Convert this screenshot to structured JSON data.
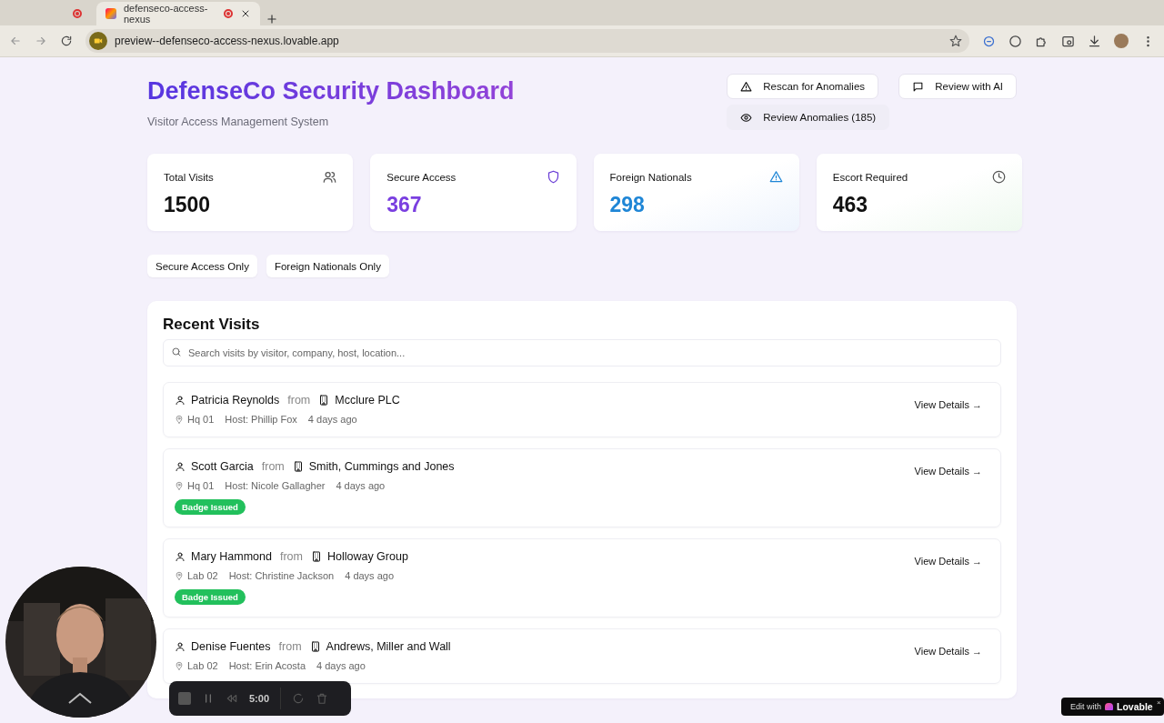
{
  "browser": {
    "tabs": [
      {
        "selected": false,
        "recording": true
      },
      {
        "title": "defenseco-access-nexus",
        "selected": true,
        "recording": true
      }
    ],
    "address": "preview--defenseco-access-nexus.lovable.app"
  },
  "header": {
    "title": "DefenseCo Security Dashboard",
    "subtitle": "Visitor Access Management System",
    "actions": [
      {
        "label": "Rescan for Anomalies",
        "kind": "outline"
      },
      {
        "label": "Review with AI",
        "kind": "outline"
      },
      {
        "label": "Review Anomalies (185)",
        "kind": "ghost"
      }
    ]
  },
  "stats": [
    {
      "label": "Total Visits",
      "value": "1500",
      "color": "#111111"
    },
    {
      "label": "Secure Access",
      "value": "367",
      "color": "#7a3fe0"
    },
    {
      "label": "Foreign Nationals",
      "value": "298",
      "color": "#1f86d6"
    },
    {
      "label": "Escort Required",
      "value": "463",
      "color": "#111111"
    }
  ],
  "filters": [
    {
      "label": "Secure Access Only",
      "selected": false
    },
    {
      "label": "Foreign Nationals Only",
      "selected": false
    }
  ],
  "recent_visits": {
    "title": "Recent Visits",
    "search": {
      "placeholder": "Search visits by visitor, company, host, location..."
    },
    "rows": [
      {
        "visitor": "Patricia Reynolds",
        "from": "from",
        "company": "Mcclure PLC",
        "location": "Hq 01",
        "host": "Host: Phillip Fox",
        "time": "4 days ago",
        "action": "View Details →"
      },
      {
        "visitor": "Scott Garcia",
        "from": "from",
        "company": "Smith, Cummings and Jones",
        "location": "Hq 01",
        "host": "Host: Nicole Gallagher",
        "time": "4 days ago",
        "badge": "Badge Issued",
        "action": "View Details →"
      },
      {
        "visitor": "Mary Hammond",
        "from": "from",
        "company": "Holloway Group",
        "location": "Lab 02",
        "host": "Host: Christine Jackson",
        "time": "4 days ago",
        "badge": "Badge Issued",
        "action": "View Details →"
      },
      {
        "visitor": "Denise Fuentes",
        "from": "from",
        "company": "Andrews, Miller and Wall",
        "location": "Lab 02",
        "host": "Host: Erin Acosta",
        "time": "4 days ago",
        "action": "View Details →"
      }
    ]
  },
  "recorder": {
    "time": "5:00"
  },
  "lovable_badge": {
    "prefix": "Edit with",
    "brand": "Lovable",
    "close": "×"
  }
}
